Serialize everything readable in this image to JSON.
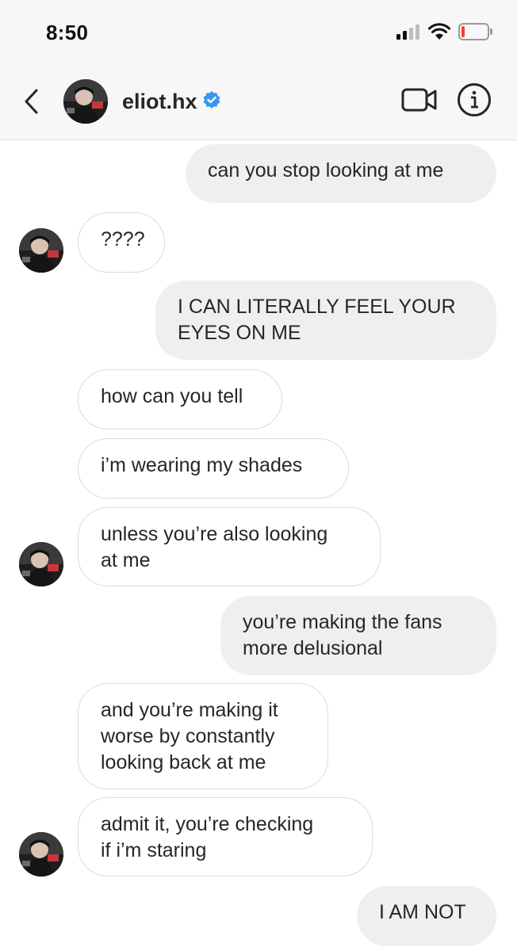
{
  "status_bar": {
    "time": "8:50",
    "icons": [
      "signal-icon",
      "wifi-icon",
      "battery-icon"
    ]
  },
  "header": {
    "back_icon": "chevron-left-icon",
    "username": "eliot.hx",
    "verified_icon": "verified-badge-icon",
    "video_icon": "video-camera-icon",
    "info_icon": "info-icon"
  },
  "colors": {
    "sent_bubble": "#efefef",
    "received_border": "#dbdbdb",
    "verified_blue": "#3897f0",
    "header_bg": "#f7f7f7"
  },
  "messages": [
    {
      "direction": "sent",
      "text": "can you stop looking at me"
    },
    {
      "direction": "received",
      "text": "????"
    },
    {
      "direction": "sent",
      "lines": [
        "I CAN LITERALLY FEEL YOUR",
        "EYES ON ME"
      ]
    },
    {
      "direction": "received",
      "text": "how can you tell"
    },
    {
      "direction": "received",
      "text": "i’m wearing my shades"
    },
    {
      "direction": "received",
      "lines": [
        "unless you’re also looking",
        "at me"
      ]
    },
    {
      "direction": "sent",
      "lines": [
        "you’re making the fans",
        "more delusional"
      ]
    },
    {
      "direction": "received",
      "lines": [
        "and you’re making it",
        "worse by constantly",
        "looking back at me"
      ]
    },
    {
      "direction": "received",
      "lines": [
        "admit it, you’re checking",
        "if i’m staring"
      ]
    },
    {
      "direction": "sent",
      "text": "I AM NOT"
    }
  ]
}
